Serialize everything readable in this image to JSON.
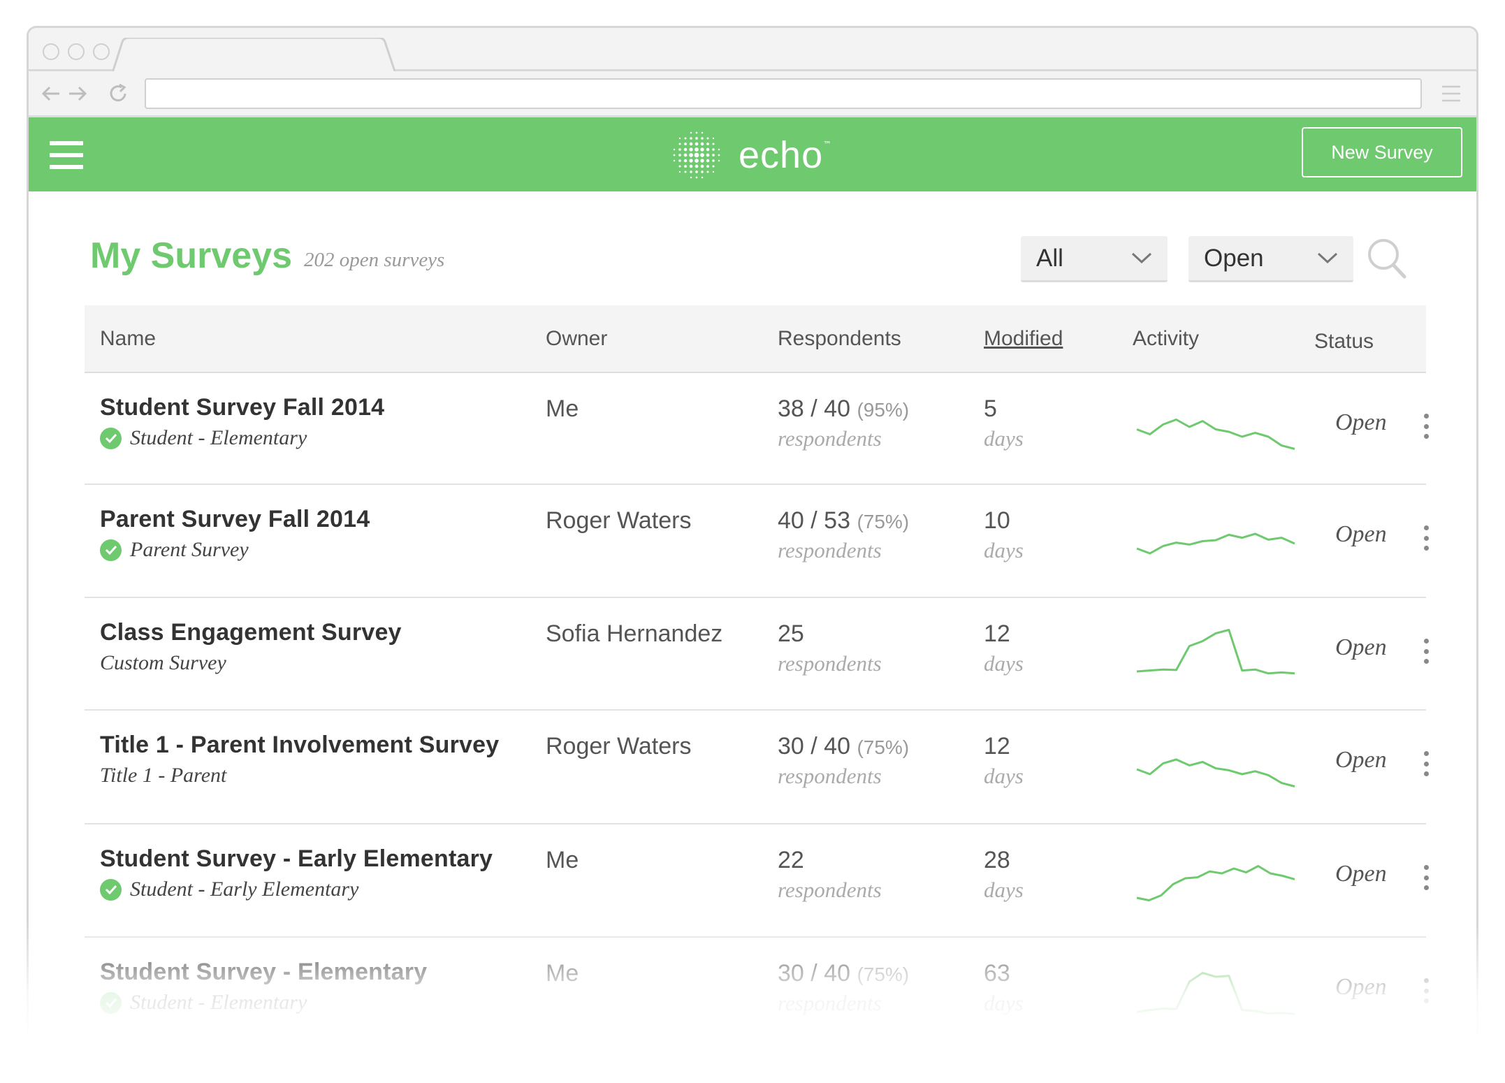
{
  "browser": {
    "url": ""
  },
  "app": {
    "logo_text": "echo",
    "logo_tm": "™",
    "new_survey_label": "New Survey",
    "brand_color": "#6fc96f"
  },
  "page": {
    "title": "My Surveys",
    "subtitle": "202 open surveys",
    "filter_type": "All",
    "filter_status": "Open"
  },
  "table": {
    "columns": [
      "Name",
      "Owner",
      "Respondents",
      "Modified",
      "Activity",
      "Status"
    ],
    "rows": [
      {
        "name": "Student Survey Fall 2014",
        "type": "Student - Elementary",
        "verified": true,
        "owner": "Me",
        "respondents": "38 / 40",
        "percent": "(95%)",
        "respondents_label": "respondents",
        "modified": "5",
        "modified_label": "days",
        "status": "Open",
        "activity": [
          0.45,
          0.35,
          0.55,
          0.65,
          0.5,
          0.62,
          0.45,
          0.4,
          0.3,
          0.38,
          0.3,
          0.12,
          0.05
        ]
      },
      {
        "name": "Parent Survey Fall 2014",
        "type": "Parent Survey",
        "verified": true,
        "owner": "Roger Waters",
        "respondents": "40 / 53",
        "percent": "(75%)",
        "respondents_label": "respondents",
        "modified": "10",
        "modified_label": "days",
        "status": "Open",
        "activity": [
          0.3,
          0.2,
          0.35,
          0.42,
          0.38,
          0.45,
          0.47,
          0.58,
          0.52,
          0.6,
          0.48,
          0.52,
          0.4
        ]
      },
      {
        "name": "Class Engagement Survey",
        "type": "Custom Survey",
        "verified": false,
        "owner": "Sofia Hernandez",
        "respondents": "25",
        "percent": "",
        "respondents_label": "respondents",
        "modified": "12",
        "modified_label": "days",
        "status": "Open",
        "activity": [
          0.1,
          0.12,
          0.14,
          0.13,
          0.62,
          0.72,
          0.88,
          0.95,
          0.12,
          0.14,
          0.06,
          0.08,
          0.06
        ]
      },
      {
        "name": "Title 1 - Parent Involvement Survey",
        "type": "Title 1 - Parent",
        "verified": false,
        "owner": "Roger Waters",
        "respondents": "30 / 40",
        "percent": "(75%)",
        "respondents_label": "respondents",
        "modified": "12",
        "modified_label": "days",
        "status": "Open",
        "activity": [
          0.4,
          0.3,
          0.52,
          0.6,
          0.48,
          0.55,
          0.42,
          0.38,
          0.3,
          0.36,
          0.28,
          0.12,
          0.05
        ]
      },
      {
        "name": "Student Survey - Early Elementary",
        "type": "Student - Early Elementary",
        "verified": true,
        "owner": "Me",
        "respondents": "22",
        "percent": "",
        "respondents_label": "respondents",
        "modified": "28",
        "modified_label": "days",
        "status": "Open",
        "activity": [
          0.1,
          0.05,
          0.15,
          0.38,
          0.5,
          0.52,
          0.64,
          0.6,
          0.7,
          0.62,
          0.75,
          0.6,
          0.55,
          0.48
        ]
      },
      {
        "name": "Student Survey - Elementary",
        "type": "Student - Elementary",
        "verified": true,
        "owner": "Me",
        "respondents": "30 / 40",
        "percent": "(75%)",
        "respondents_label": "respondents",
        "modified": "63",
        "modified_label": "days",
        "status": "Open",
        "activity": [
          0.08,
          0.12,
          0.15,
          0.14,
          0.7,
          0.88,
          0.8,
          0.82,
          0.12,
          0.1,
          0.05,
          0.06,
          0.04
        ]
      }
    ]
  }
}
